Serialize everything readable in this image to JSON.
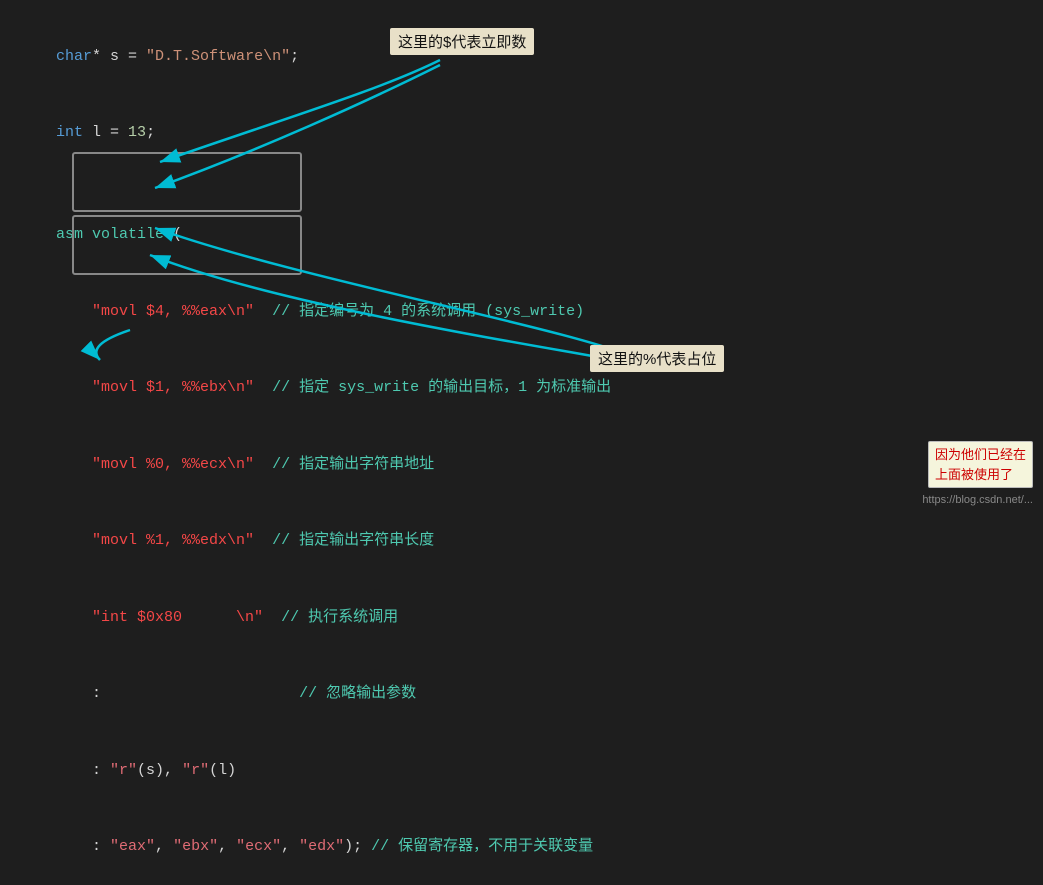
{
  "lines": [
    {
      "id": "l1",
      "parts": [
        {
          "t": "char",
          "c": "kw"
        },
        {
          "t": "* s = ",
          "c": "plain"
        },
        {
          "t": "\"D.T.Software\\n\"",
          "c": "str"
        },
        {
          "t": ";",
          "c": "plain"
        }
      ]
    },
    {
      "id": "l2",
      "parts": [
        {
          "t": "int",
          "c": "kw"
        },
        {
          "t": " l = ",
          "c": "plain"
        },
        {
          "t": "13",
          "c": "num"
        },
        {
          "t": ";",
          "c": "plain"
        }
      ]
    },
    {
      "id": "l3",
      "parts": []
    },
    {
      "id": "l4",
      "parts": [
        {
          "t": "asm",
          "c": "asm-kw"
        },
        {
          "t": " ",
          "c": "plain"
        },
        {
          "t": "volatile",
          "c": "asm-kw"
        },
        {
          "t": " (",
          "c": "plain"
        }
      ]
    },
    {
      "id": "l5",
      "parts": [
        {
          "t": "    ",
          "c": "plain"
        },
        {
          "t": "\"movl $4, %%eax\\n\"",
          "c": "red-str"
        },
        {
          "t": "  // 指定编号为 4 的系统调用 (sys_write)",
          "c": "comment"
        }
      ]
    },
    {
      "id": "l6",
      "parts": [
        {
          "t": "    ",
          "c": "plain"
        },
        {
          "t": "\"movl $1, %%ebx\\n\"",
          "c": "red-str"
        },
        {
          "t": "  // 指定 sys_write 的输出目标，1 为标准输出",
          "c": "comment"
        }
      ]
    },
    {
      "id": "l7",
      "parts": [
        {
          "t": "    ",
          "c": "plain"
        },
        {
          "t": "\"movl %0, %%ecx\\n\"",
          "c": "red-str"
        },
        {
          "t": "  // 指定输出字符串地址",
          "c": "comment"
        }
      ]
    },
    {
      "id": "l8",
      "parts": [
        {
          "t": "    ",
          "c": "plain"
        },
        {
          "t": "\"movl %1, %%edx\\n\"",
          "c": "red-str"
        },
        {
          "t": "  // 指定输出字符串长度",
          "c": "comment"
        }
      ]
    },
    {
      "id": "l9",
      "parts": [
        {
          "t": "    ",
          "c": "plain"
        },
        {
          "t": "\"int $0x80      \\n\"",
          "c": "red-str"
        },
        {
          "t": "  // 执行系统调用",
          "c": "comment"
        }
      ]
    },
    {
      "id": "l10",
      "parts": [
        {
          "t": "    :",
          "c": "plain"
        },
        {
          "t": "                      // 忽略输出参数",
          "c": "comment"
        }
      ]
    },
    {
      "id": "l11",
      "parts": [
        {
          "t": "    : ",
          "c": "plain"
        },
        {
          "t": "\"r\"",
          "c": "pink-str"
        },
        {
          "t": "(s), ",
          "c": "plain"
        },
        {
          "t": "\"r\"",
          "c": "pink-str"
        },
        {
          "t": "(l)",
          "c": "plain"
        }
      ]
    },
    {
      "id": "l12",
      "parts": [
        {
          "t": "    : ",
          "c": "plain"
        },
        {
          "t": "\"eax\"",
          "c": "pink-str"
        },
        {
          "t": ", ",
          "c": "plain"
        },
        {
          "t": "\"ebx\"",
          "c": "pink-str"
        },
        {
          "t": ", ",
          "c": "plain"
        },
        {
          "t": "\"ecx\"",
          "c": "pink-str"
        },
        {
          "t": ", ",
          "c": "plain"
        },
        {
          "t": "\"edx\"",
          "c": "pink-str"
        },
        {
          "t": "); // 保留寄存器，不用于关联变量",
          "c": "comment"
        }
      ]
    }
  ],
  "annotations": {
    "immediate": "这里的$代表立即数",
    "placeholder": "这里的%代表占位",
    "note": "因为他们已经在\n上面被使用了"
  },
  "watermark": "https://blog.csdn.net/...",
  "colors": {
    "bg": "#1e1e1e",
    "arrow": "#00bcd4"
  }
}
